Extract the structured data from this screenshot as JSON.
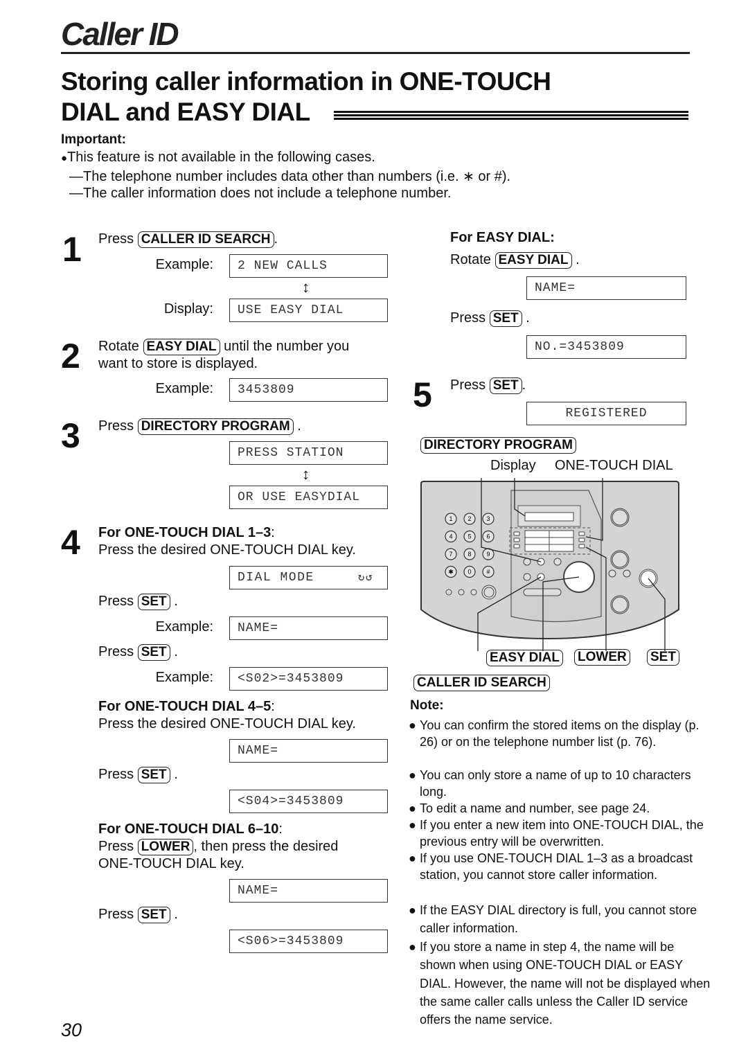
{
  "header": {
    "chapter": "Caller ID",
    "section_title_line1": "Storing caller information in ONE-TOUCH",
    "section_title_line2": "DIAL and EASY DIAL"
  },
  "important": {
    "label": "Important:",
    "bullet": "●",
    "line1": "This feature is not available in the following cases.",
    "line2": "—The telephone number includes data other than numbers (i.e. ∗ or #).",
    "line3": "—The caller information does not include a telephone number."
  },
  "steps": {
    "s1": {
      "num": "1",
      "press": "Press",
      "key": "CALLER ID SEARCH",
      "dot": ".",
      "example_label": "Example:",
      "example_lcd": "2 NEW CALLS",
      "display_label": "Display:",
      "display_lcd": "USE EASY DIAL"
    },
    "s2": {
      "num": "2",
      "rotate": "Rotate",
      "key": "EASY DIAL",
      "text_after": "until the number you",
      "text_line2": "want to store is displayed.",
      "example_label": "Example:",
      "example_lcd": "3453809"
    },
    "s3": {
      "num": "3",
      "press": "Press",
      "key": "DIRECTORY PROGRAM",
      "dot": ".",
      "lcd1": "PRESS STATION",
      "lcd2": "OR USE EASYDIAL"
    },
    "s4": {
      "num": "4",
      "heading_1_3": "For ONE-TOUCH DIAL 1–3",
      "colon": ":",
      "press_desired": "Press the desired ONE-TOUCH DIAL key.",
      "lcd_dial_mode": "DIAL MODE",
      "dial_mode_icon": "↻↺",
      "press": "Press",
      "set_key": "SET",
      "dot": ".",
      "example_label": "Example:",
      "lcd_name": "NAME=",
      "lcd_s02": "<S02>=3453809",
      "heading_4_5": "For ONE-TOUCH DIAL 4–5",
      "lcd_name_45": "NAME=",
      "lcd_s04": "<S04>=3453809",
      "heading_6_10": "For ONE-TOUCH DIAL 6–10",
      "lower_key": "LOWER",
      "then_press": ", then press the desired",
      "key_line": "ONE-TOUCH DIAL key.",
      "lcd_name_610": "NAME=",
      "lcd_s06": "<S06>=3453809"
    },
    "easy": {
      "heading": "For EASY DIAL:",
      "rotate": "Rotate",
      "key": "EASY DIAL",
      "dot": ".",
      "lcd_name": "NAME=",
      "press": "Press",
      "set_key": "SET",
      "lcd_no": "NO.=3453809"
    },
    "s5": {
      "num": "5",
      "press": "Press",
      "set_key": "SET",
      "dot": ".",
      "lcd": "REGISTERED"
    }
  },
  "diagram": {
    "directory_program": "DIRECTORY PROGRAM",
    "display_label": "Display",
    "one_touch_label": "ONE-TOUCH DIAL",
    "easy_dial": "EASY DIAL",
    "lower": "LOWER",
    "set": "SET",
    "caller_id_search": "CALLER ID SEARCH",
    "keypad": [
      "1",
      "2",
      "3",
      "4",
      "5",
      "6",
      "7",
      "8",
      "9",
      "✱",
      "0",
      "#"
    ]
  },
  "note": {
    "label": "Note:",
    "bullet": "●",
    "items": [
      "You can confirm the stored items on the display (p. 26) or on the telephone number list (p. 76).",
      "You can only store a name of up to 10 characters long.",
      "To edit a name and number, see page 24.",
      "If you enter a new item into ONE-TOUCH DIAL, the previous entry will be overwritten.",
      "If you use ONE-TOUCH DIAL 1–3 as a broadcast station, you cannot store caller information.",
      "If the EASY DIAL directory is full, you cannot store caller information.",
      "If you store a name in step 4, the name will be shown when using ONE-TOUCH DIAL or EASY DIAL. However, the name will not be displayed when the same caller calls unless the Caller ID service offers the name service."
    ]
  },
  "footer": {
    "page_number": "30"
  }
}
